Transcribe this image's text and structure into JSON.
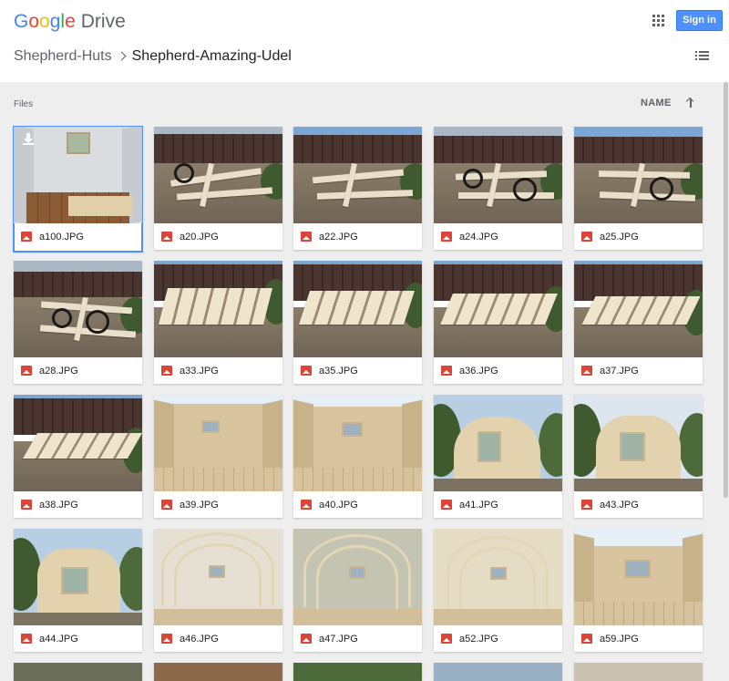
{
  "header": {
    "logo_google": "Google",
    "logo_drive": "Drive",
    "signin_label": "Sign in"
  },
  "breadcrumb": {
    "parent": "Shepherd-Huts",
    "current": "Shepherd-Amazing-Udel"
  },
  "toolbar": {
    "files_label": "Files",
    "sort_label": "NAME"
  },
  "icons": {
    "apps": "apps-grid-icon",
    "list_view": "list-view-icon",
    "sort": "arrow-up-icon",
    "file_type": "image-file-icon",
    "download": "download-icon"
  },
  "colors": {
    "signin_bg": "#4d90fe",
    "file_icon": "#db4437",
    "selected_outline": "#4d90fe",
    "content_bg": "#eeeeee"
  },
  "files": [
    {
      "name": "a100.JPG"
    },
    {
      "name": "a20.JPG"
    },
    {
      "name": "a22.JPG"
    },
    {
      "name": "a24.JPG"
    },
    {
      "name": "a25.JPG"
    },
    {
      "name": "a28.JPG"
    },
    {
      "name": "a33.JPG"
    },
    {
      "name": "a35.JPG"
    },
    {
      "name": "a36.JPG"
    },
    {
      "name": "a37.JPG"
    },
    {
      "name": "a38.JPG"
    },
    {
      "name": "a39.JPG"
    },
    {
      "name": "a40.JPG"
    },
    {
      "name": "a41.JPG"
    },
    {
      "name": "a43.JPG"
    },
    {
      "name": "a44.JPG"
    },
    {
      "name": "a46.JPG"
    },
    {
      "name": "a47.JPG"
    },
    {
      "name": "a52.JPG"
    },
    {
      "name": "a59.JPG"
    }
  ]
}
